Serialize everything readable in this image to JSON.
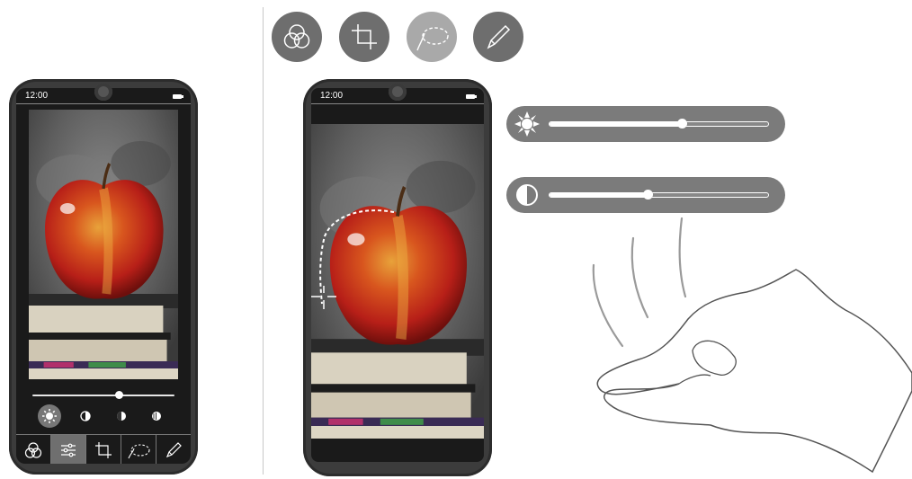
{
  "left_phone": {
    "status_time": "12:00",
    "brightness_slider_value": 0.63,
    "adjust_modes": [
      "brightness",
      "contrast",
      "shadows",
      "highlights"
    ],
    "selected_mode": "brightness",
    "toolbar": [
      "filters",
      "adjust",
      "crop",
      "selection",
      "brush"
    ],
    "active_tool": "adjust"
  },
  "right_phone": {
    "status_time": "12:00"
  },
  "top_tools": [
    "filters",
    "crop",
    "selection",
    "brush"
  ],
  "active_top_tool": "selection",
  "adjustments": [
    {
      "name": "brightness",
      "value": 0.6
    },
    {
      "name": "contrast",
      "value": 0.45
    }
  ],
  "colors": {
    "frame": "#3c3c3c",
    "tool_bg": "#6e6e6e",
    "tool_active": "#a9a9a9",
    "pill_bg": "#7b7b7b",
    "apple_red": "#c7241c"
  }
}
